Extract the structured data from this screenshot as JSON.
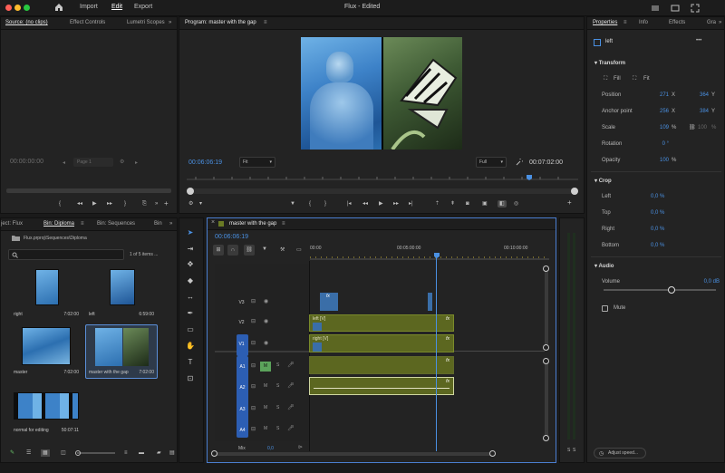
{
  "colors": {
    "accent": "#4a90e2",
    "clip": "#5c6720",
    "track_on": "#2c5eb3",
    "mute_on": "#5ba35b"
  },
  "topbar": {
    "title": "Flux - Edited",
    "nav": [
      "Import",
      "Edit",
      "Export"
    ],
    "active_nav": "Edit"
  },
  "source": {
    "tabs": [
      "Source: (no clips)",
      "Effect Controls",
      "Lumetri Scopes"
    ],
    "timecode": "00:00:00:00",
    "page": "Page 1"
  },
  "program": {
    "tab": "Program: master with the gap",
    "timecode": "00:06:06:19",
    "fit": "Fit",
    "quality": "Full",
    "duration": "00:07:02:00"
  },
  "project": {
    "tabs": [
      "ject: Flux",
      "Bin: Diploma",
      "Bin: Sequences",
      "Bin"
    ],
    "path": "Flux.prproj\\Sequences\\Diploma",
    "count": "1 of 5 items ...",
    "items": [
      {
        "name": "right",
        "dur": "7:02:00"
      },
      {
        "name": "left",
        "dur": "6:59:00"
      },
      {
        "name": "master",
        "dur": "7:02:00"
      },
      {
        "name": "master with the gap",
        "dur": "7:02:00"
      },
      {
        "name": "normal for editing",
        "dur": "50:07:11"
      }
    ]
  },
  "timeline": {
    "tab": "master with the gap",
    "timecode": "00:06:06:19",
    "ruler": [
      "00:00",
      "00:05:00:00",
      "00:10:00:00"
    ],
    "tracks": {
      "video": [
        "V3",
        "V2",
        "V1"
      ],
      "audio": [
        "A1",
        "A2",
        "A3",
        "A4"
      ],
      "mix": "Mix",
      "mix_val": "0,0"
    },
    "ms": {
      "m": "M",
      "s": "S"
    },
    "clips": {
      "v2": "left [V]",
      "v1": "right [V]",
      "fx": "fx"
    }
  },
  "properties": {
    "tabs": [
      "Properties",
      "Info",
      "Effects",
      "Gra"
    ],
    "layer": "left",
    "transform": {
      "title": "Transform",
      "fill": "Fill",
      "fit": "Fit",
      "position": {
        "label": "Position",
        "x": "271",
        "y": "364"
      },
      "anchor": {
        "label": "Anchor point",
        "x": "256",
        "y": "384"
      },
      "scale": {
        "label": "Scale",
        "val": "109",
        "unit": "%",
        "w": "100"
      },
      "rotation": {
        "label": "Rotation",
        "val": "0 °"
      },
      "opacity": {
        "label": "Opacity",
        "val": "100",
        "unit": "%"
      }
    },
    "crop": {
      "title": "Crop",
      "left": {
        "label": "Left",
        "val": "0,0 %"
      },
      "top": {
        "label": "Top",
        "val": "0,0 %"
      },
      "right": {
        "label": "Right",
        "val": "0,0 %"
      },
      "bottom": {
        "label": "Bottom",
        "val": "0,0 %"
      }
    },
    "audio": {
      "title": "Audio",
      "volume_label": "Volume",
      "volume_val": "0,0 dB",
      "mute": "Mute"
    },
    "adjust": "Adjust speed..."
  },
  "meter": {
    "labels": [
      "S",
      "S"
    ]
  }
}
